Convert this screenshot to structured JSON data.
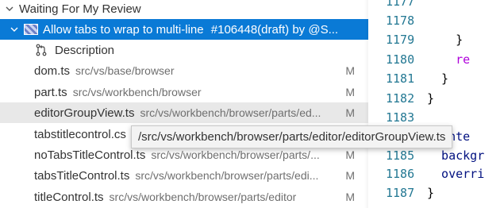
{
  "section": {
    "label": "Waiting For My Review"
  },
  "pull_request": {
    "title": "Allow tabs to wrap to multi-line",
    "meta": "#106448(draft) by @S..."
  },
  "description": {
    "label": "Description"
  },
  "files": [
    {
      "name": "dom.ts",
      "path": "src/vs/base/browser",
      "status": "M"
    },
    {
      "name": "part.ts",
      "path": "src/vs/workbench/browser",
      "status": "M"
    },
    {
      "name": "editorGroupView.ts",
      "path": "src/vs/workbench/browser/parts/ed...",
      "status": "M"
    },
    {
      "name": "tabstitlecontrol.cs",
      "path": "",
      "status": ""
    },
    {
      "name": "noTabsTitleControl.ts",
      "path": "src/vs/workbench/browser/parts/...",
      "status": "M"
    },
    {
      "name": "tabsTitleControl.ts",
      "path": "src/vs/workbench/browser/parts/edi...",
      "status": "M"
    },
    {
      "name": "titleControl.ts",
      "path": "src/vs/workbench/browser/parts/editor",
      "status": "M"
    }
  ],
  "tooltip": {
    "text": "/src/vs/workbench/browser/parts/editor/editorGroupView.ts"
  },
  "editor": {
    "lines": [
      {
        "num": "1177",
        "code": ""
      },
      {
        "num": "1178",
        "code": ""
      },
      {
        "num": "1179",
        "code": "    }"
      },
      {
        "num": "1180",
        "code": "    re"
      },
      {
        "num": "1181",
        "code": "  }"
      },
      {
        "num": "1182",
        "code": "}"
      },
      {
        "num": "1183",
        "code": ""
      },
      {
        "num": "1184",
        "code": "  inte"
      },
      {
        "num": "1185",
        "code": "  backgr"
      },
      {
        "num": "1186",
        "code": "  overri"
      },
      {
        "num": "1187",
        "code": "}"
      }
    ]
  },
  "colors": {
    "selection": "#0a7ad6",
    "hover_row": "#e8e8e8",
    "line_number": "#237893",
    "keyword": "#af00db"
  }
}
